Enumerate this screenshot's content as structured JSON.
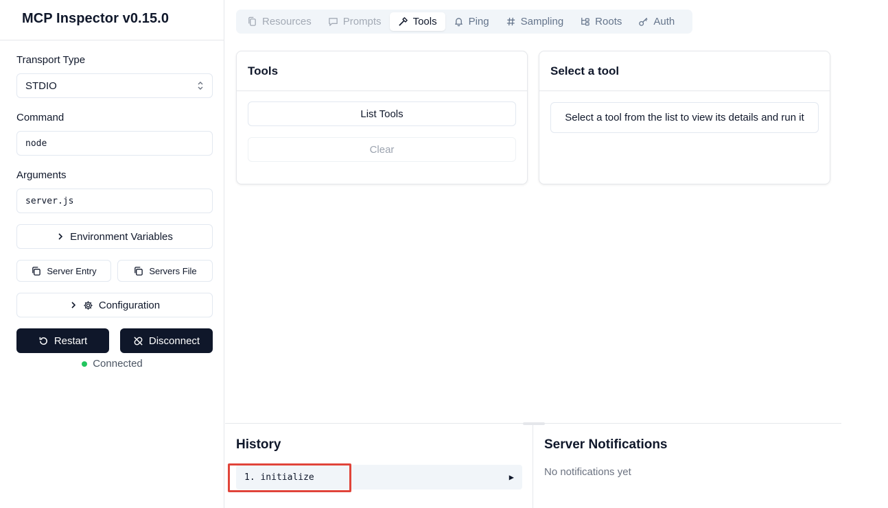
{
  "sidebar": {
    "title": "MCP Inspector v0.15.0",
    "transport_label": "Transport Type",
    "transport_value": "STDIO",
    "command_label": "Command",
    "command_value": "node",
    "arguments_label": "Arguments",
    "arguments_value": "server.js",
    "env_button": "Environment Variables",
    "server_entry_button": "Server Entry",
    "servers_file_button": "Servers File",
    "configuration_button": "Configuration",
    "restart_button": "Restart",
    "disconnect_button": "Disconnect",
    "status": "Connected",
    "status_color": "#22c55e"
  },
  "tabs": [
    {
      "label": "Resources",
      "icon": "file-copy-icon",
      "state": "disabled"
    },
    {
      "label": "Prompts",
      "icon": "message-icon",
      "state": "disabled"
    },
    {
      "label": "Tools",
      "icon": "hammer-icon",
      "state": "active"
    },
    {
      "label": "Ping",
      "icon": "bell-icon",
      "state": "normal"
    },
    {
      "label": "Sampling",
      "icon": "hash-icon",
      "state": "normal"
    },
    {
      "label": "Roots",
      "icon": "tree-icon",
      "state": "normal"
    },
    {
      "label": "Auth",
      "icon": "key-icon",
      "state": "normal"
    }
  ],
  "tools_card": {
    "title": "Tools",
    "list_button": "List Tools",
    "clear_button": "Clear"
  },
  "select_card": {
    "title": "Select a tool",
    "message": "Select a tool from the list to view its details and run it"
  },
  "history": {
    "title": "History",
    "items": [
      {
        "text": "1. initialize"
      }
    ]
  },
  "notifications": {
    "title": "Server Notifications",
    "empty": "No notifications yet"
  },
  "colors": {
    "dark_button": "#0f172a",
    "highlight": "#e0443a"
  }
}
